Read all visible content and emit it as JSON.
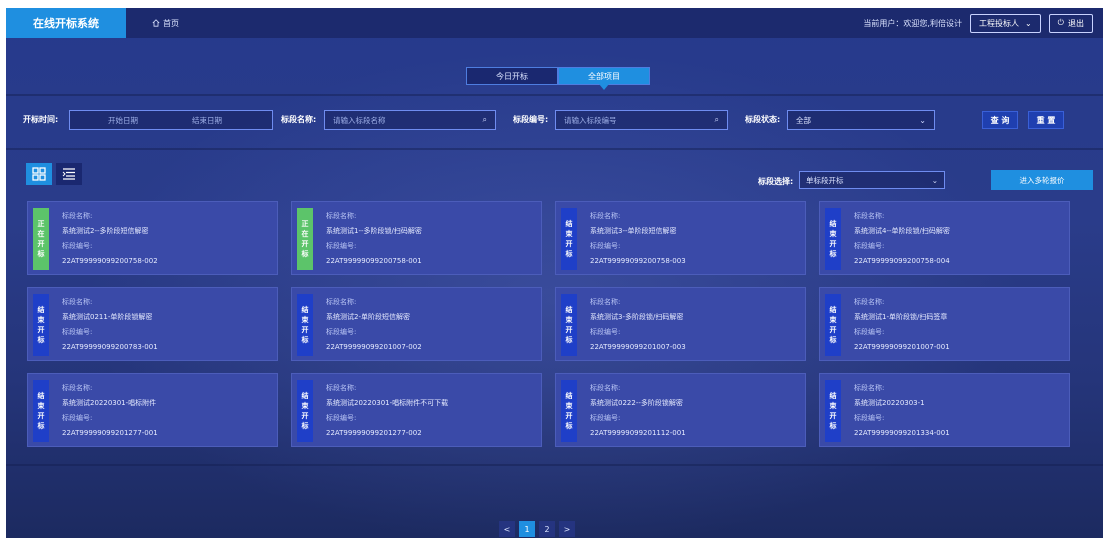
{
  "app": {
    "title": "在线开标系统"
  },
  "header": {
    "home_label": "首页",
    "user_text": "当前用户：欢迎您,利倍设计",
    "role_label": "工程投标人",
    "logout_label": "退出"
  },
  "tabs": [
    {
      "label": "今日开标",
      "active": false
    },
    {
      "label": "全部项目",
      "active": true
    }
  ],
  "filters": {
    "time_label": "开标时间:",
    "start_placeholder": "开始日期",
    "end_placeholder": "结束日期",
    "name_label": "标段名称:",
    "name_placeholder": "请输入标段名称",
    "code_label": "标段编号:",
    "code_placeholder": "请输入标段编号",
    "status_label": "标段状态:",
    "status_value": "全部",
    "query_label": "查 询",
    "reset_label": "重 置"
  },
  "toolbar": {
    "section_label": "标段选择:",
    "section_value": "单标段开标",
    "multi_label": "进入多轮报价"
  },
  "card_labels": {
    "name": "标段名称:",
    "code": "标段编号:"
  },
  "cards": [
    {
      "status": "正在开标",
      "state": "open",
      "name": "系统测试2--多阶段短信解密",
      "code": "22AT99999099200758-002"
    },
    {
      "status": "正在开标",
      "state": "open",
      "name": "系统测试1--多阶段锁/扫码解密",
      "code": "22AT99999099200758-001"
    },
    {
      "status": "结束开标",
      "state": "closed",
      "name": "系统测试3--单阶段短信解密",
      "code": "22AT99999099200758-003"
    },
    {
      "status": "结束开标",
      "state": "closed",
      "name": "系统测试4--单阶段锁/扫码解密",
      "code": "22AT99999099200758-004"
    },
    {
      "status": "结束开标",
      "state": "closed",
      "name": "系统测试0211-单阶段锁解密",
      "code": "22AT99999099200783-001"
    },
    {
      "status": "结束开标",
      "state": "closed",
      "name": "系统测试2-单阶段短信解密",
      "code": "22AT99999099201007-002"
    },
    {
      "status": "结束开标",
      "state": "closed",
      "name": "系统测试3-多阶段锁/扫码解密",
      "code": "22AT99999099201007-003"
    },
    {
      "status": "结束开标",
      "state": "closed",
      "name": "系统测试1-单阶段锁/扫码签章",
      "code": "22AT99999099201007-001"
    },
    {
      "status": "结束开标",
      "state": "closed",
      "name": "系统测试20220301-唱标附件",
      "code": "22AT99999099201277-001"
    },
    {
      "status": "结束开标",
      "state": "closed",
      "name": "系统测试20220301-唱标附件不可下载",
      "code": "22AT99999099201277-002"
    },
    {
      "status": "结束开标",
      "state": "closed",
      "name": "系统测试0222--多阶段锁解密",
      "code": "22AT99999099201112-001"
    },
    {
      "status": "结束开标",
      "state": "closed",
      "name": "系统测试20220303-1",
      "code": "22AT99999099201334-001"
    }
  ],
  "pagination": {
    "prev": "<",
    "pages": [
      "1",
      "2"
    ],
    "current": "1",
    "next": ">"
  },
  "colors": {
    "accent": "#1f8fe0",
    "open_badge": "#5cc46a",
    "closed_badge": "#1f3fc8",
    "card_bg": "#3a4aa8"
  }
}
